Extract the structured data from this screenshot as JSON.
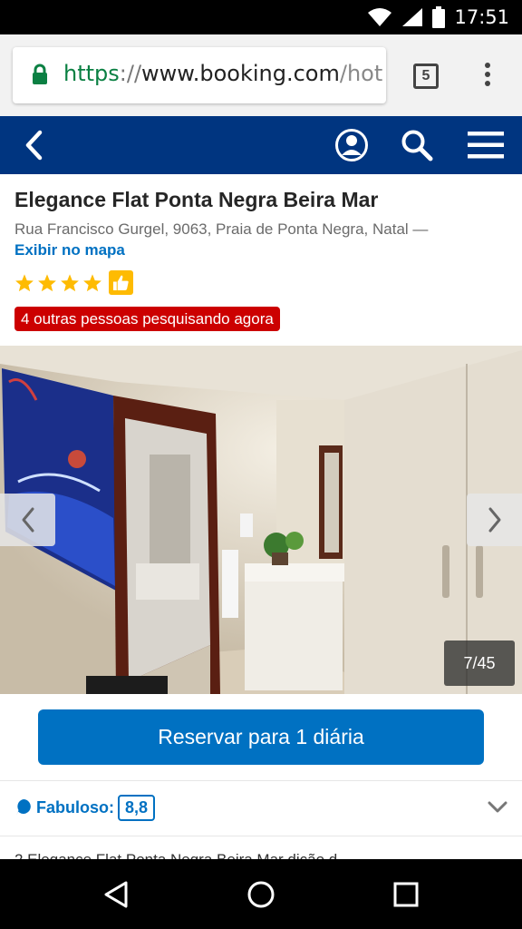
{
  "status_bar": {
    "time": "17:51"
  },
  "browser": {
    "url_scheme": "https",
    "url_sep": "://",
    "url_host": "www.booking.com",
    "url_path": "/hot",
    "tab_count": "5"
  },
  "hotel": {
    "title": "Elegance Flat Ponta Negra Beira Mar",
    "address": "Rua Francisco Gurgel, 9063, Praia de Ponta Negra, Natal —",
    "map_link": "Exibir no mapa",
    "star_count": 4,
    "viewers": "4 outras pessoas pesquisando agora"
  },
  "gallery": {
    "counter": "7/45"
  },
  "reserve": {
    "label": "Reservar para 1 diária"
  },
  "review": {
    "label": "Fabuloso:",
    "score": "8,8"
  },
  "next_section_text": "2 Elegance Flat Ponta Negra Beira Mar dição d",
  "colors": {
    "brand_blue": "#003580",
    "action_blue": "#0071c2",
    "star_yellow": "#febb02",
    "alert_red": "#cc0000"
  }
}
